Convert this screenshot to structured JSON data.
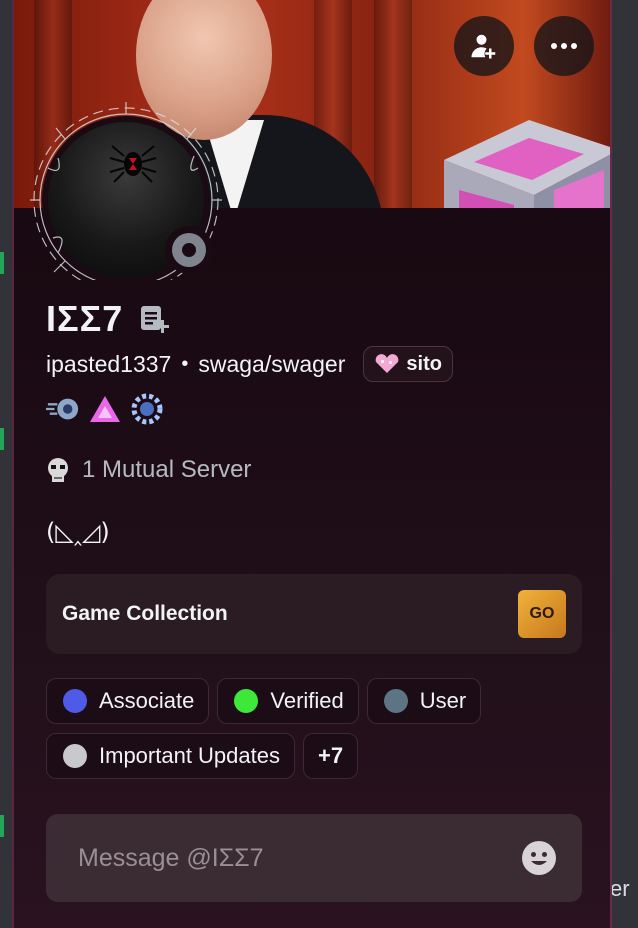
{
  "profile": {
    "display_name": "ΙΣΣ7",
    "username": "ipasted1337",
    "separator": "•",
    "pronouns": "swaga/swager",
    "clan_tag": "sito",
    "mutual_servers": "1 Mutual Server",
    "bio": "(◺‸◿)",
    "status": "offline"
  },
  "banner_actions": {
    "add_friend_icon": "add-friend-icon",
    "more_icon": "more-icon"
  },
  "badges": [
    "nitro-badge",
    "hypesquad-badge",
    "server-booster-badge"
  ],
  "game_collection": {
    "label": "Game Collection",
    "game_icon_text": "GO"
  },
  "roles": [
    {
      "name": "Associate",
      "color": "#4f5ae6"
    },
    {
      "name": "Verified",
      "color": "#3ee83a"
    },
    {
      "name": "User",
      "color": "#5d7582"
    },
    {
      "name": "Important Updates",
      "color": "#c9c9cd"
    }
  ],
  "roles_more": "+7",
  "message": {
    "placeholder": "Message @ΙΣΣ7"
  },
  "background": {
    "right_text": "er"
  },
  "colors": {
    "card_bg": "#1a0a13",
    "accent": "#6a2a4a"
  }
}
